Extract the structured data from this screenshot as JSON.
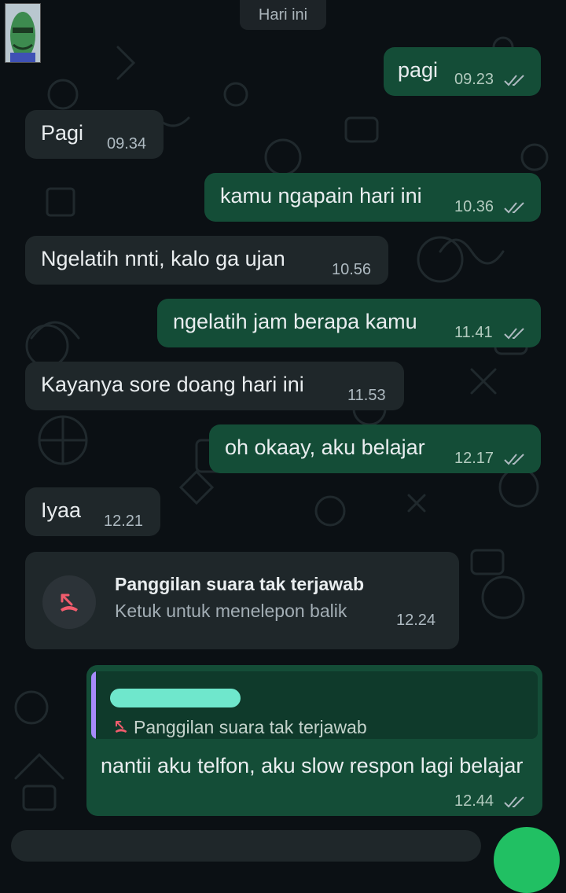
{
  "header": {
    "date_chip": "Hari ini"
  },
  "messages": [
    {
      "dir": "out",
      "text": "pagi",
      "time": "09.23",
      "status": "read"
    },
    {
      "dir": "in",
      "text": "Pagi",
      "time": "09.34"
    },
    {
      "dir": "out",
      "text": "kamu ngapain hari ini",
      "time": "10.36",
      "status": "read"
    },
    {
      "dir": "in",
      "text": "Ngelatih nnti, kalo ga ujan",
      "time": "10.56"
    },
    {
      "dir": "out",
      "text": "ngelatih jam berapa kamu",
      "time": "11.41",
      "status": "read"
    },
    {
      "dir": "in",
      "text": "Kayanya sore doang hari ini",
      "time": "11.53"
    },
    {
      "dir": "out",
      "text": "oh okaay, aku belajar",
      "time": "12.17",
      "status": "read"
    },
    {
      "dir": "in",
      "text": "Iyaa",
      "time": "12.21"
    }
  ],
  "missed_call": {
    "title": "Panggilan suara tak terjawab",
    "subtitle": "Ketuk untuk menelepon balik",
    "time": "12.24"
  },
  "reply_message": {
    "quoted_text": "Panggilan suara tak terjawab",
    "text": "nantii aku telfon, aku slow respon lagi belajar",
    "time": "12.44",
    "status": "read"
  },
  "colors": {
    "outgoing_bubble": "#144d37",
    "incoming_bubble": "#1f272a",
    "missed_call_red": "#f15c6d",
    "quote_bar": "#a78bfa",
    "redaction_highlight": "#6fe7cc",
    "accent_green": "#21c063"
  }
}
